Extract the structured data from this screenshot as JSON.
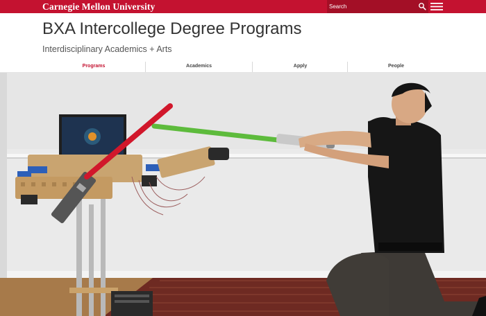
{
  "topbar": {
    "brand": "Carnegie Mellon University",
    "search_placeholder": "Search",
    "accent_color": "#c41230",
    "icons": [
      "search-icon",
      "hamburger-menu-icon"
    ]
  },
  "header": {
    "title": "BXA Intercollege Degree Programs",
    "subtitle": "Interdisciplinary Academics + Arts"
  },
  "nav": {
    "items": [
      {
        "label": "Programs",
        "active": true
      },
      {
        "label": "Academics",
        "active": false
      },
      {
        "label": "Apply",
        "active": false
      },
      {
        "label": "People",
        "active": false
      }
    ]
  }
}
